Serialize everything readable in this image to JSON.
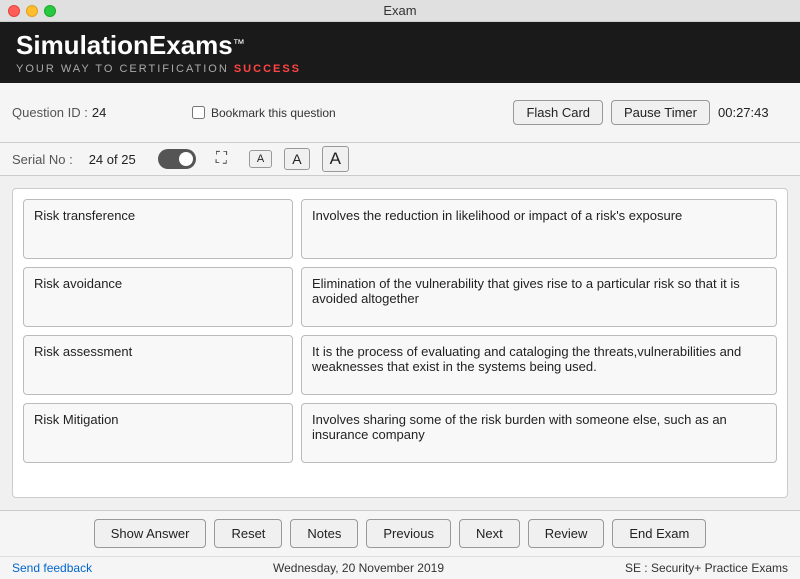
{
  "titlebar": {
    "title": "Exam"
  },
  "header": {
    "logo": "SimulationExams",
    "tm": "™",
    "tagline_before": "YOUR WAY TO CERTIFICATION ",
    "tagline_highlight": "SUCCESS"
  },
  "infobar": {
    "question_id_label": "Question ID :",
    "question_id_value": "24",
    "serial_no_label": "Serial No :",
    "serial_no_value": "24 of 25",
    "bookmark_label": "Bookmark this question",
    "flash_card_label": "Flash Card",
    "pause_timer_label": "Pause Timer",
    "timer_value": "00:27:43"
  },
  "font_buttons": {
    "small": "A",
    "medium": "A",
    "large": "A"
  },
  "matching": {
    "rows": [
      {
        "left": "Risk transference",
        "right": "Involves the reduction in likelihood or impact of a risk's exposure"
      },
      {
        "left": "Risk avoidance",
        "right": "Elimination of the vulnerability that gives rise to a particular risk so that it is avoided altogether"
      },
      {
        "left": "Risk assessment",
        "right": "It is the process of evaluating and cataloging the threats,vulnerabilities and weaknesses that exist in the systems being used."
      },
      {
        "left": "Risk Mitigation",
        "right": "Involves sharing some of the risk burden with someone else, such as an insurance company"
      }
    ]
  },
  "buttons": {
    "show_answer": "Show Answer",
    "reset": "Reset",
    "notes": "Notes",
    "previous": "Previous",
    "next": "Next",
    "review": "Review",
    "end_exam": "End Exam"
  },
  "footer": {
    "send_feedback": "Send feedback",
    "date": "Wednesday, 20 November 2019",
    "exam_name": "SE : Security+ Practice Exams"
  }
}
